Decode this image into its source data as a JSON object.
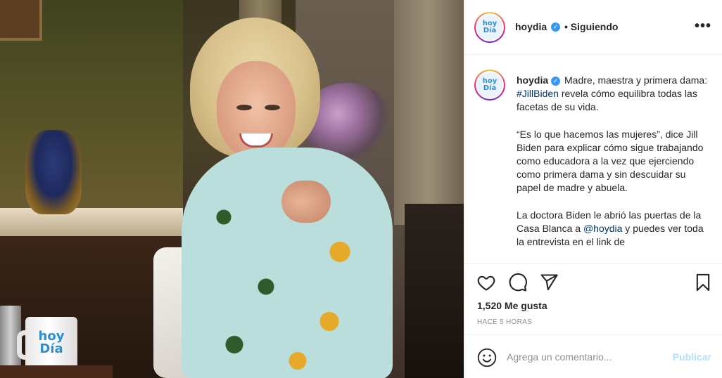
{
  "post": {
    "username": "hoydia",
    "verified_icon": "verified-badge-icon",
    "following_label": "• Siguiendo",
    "avatar_text_top": "hoy",
    "avatar_text_bottom": "Día",
    "more_icon": "more-options-icon"
  },
  "photo": {
    "mug_text_top": "hoy",
    "mug_text_bottom": "Día"
  },
  "caption": {
    "username": "hoydia",
    "p1_a": " Madre, maestra y primera dama: ",
    "p1_tag": "#JillBiden",
    "p1_b": " revela cómo equilibra todas las facetas de su vida.",
    "p2": "“Es lo que hacemos las mujeres”, dice Jill Biden para explicar cómo sigue trabajando como educadora a la vez que ejerciendo como primera dama y sin descuidar su papel de madre y abuela.",
    "p3_a": "La doctora Biden le abrió las puertas de la Casa Blanca a ",
    "p3_mention": "@hoydia",
    "p3_b": " y puedes ver toda la entrevista en el link de"
  },
  "actions": {
    "like_icon": "heart-icon",
    "comment_icon": "comment-icon",
    "share_icon": "share-icon",
    "save_icon": "bookmark-icon",
    "likes": "1,520 Me gusta",
    "time": "HACE 5 HORAS"
  },
  "comment": {
    "emoji_icon": "smiley-icon",
    "placeholder": "Agrega un comentario...",
    "publish_label": "Publicar"
  },
  "colors": {
    "link": "#00376b",
    "verified": "#3897f0",
    "publish_disabled": "#b2dffc",
    "meta_gray": "#8e8e8e",
    "brand_blue": "#2e8fd0"
  }
}
